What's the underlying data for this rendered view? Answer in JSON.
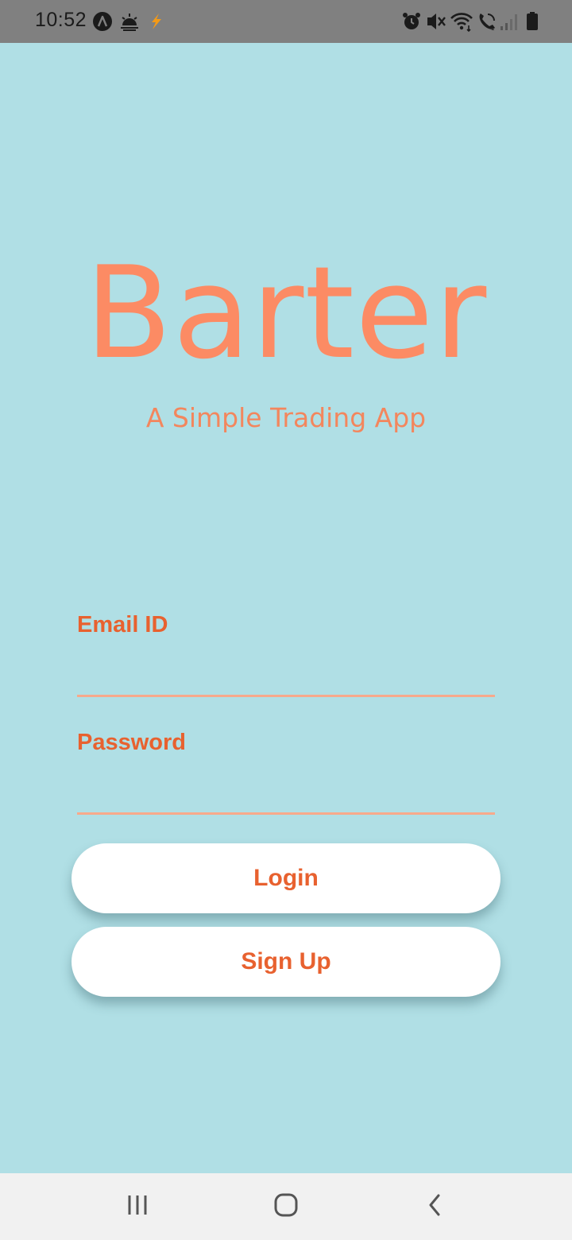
{
  "status_bar": {
    "time": "10:52",
    "left_icons": [
      "a-circle-icon",
      "sunrise-icon",
      "lightning-icon"
    ],
    "right_icons": [
      "alarm-icon",
      "vibrate-mute-icon",
      "wifi-icon",
      "wifi-call-icon",
      "signal-icon",
      "battery-icon"
    ]
  },
  "app": {
    "title": "Barter",
    "subtitle": "A Simple Trading App",
    "colors": {
      "background": "#b0dfe5",
      "accent": "#fc8b64",
      "label": "#e8612f"
    }
  },
  "form": {
    "email_label": "Email ID",
    "email_value": "",
    "password_label": "Password",
    "password_value": ""
  },
  "buttons": {
    "login": "Login",
    "signup": "Sign Up"
  },
  "nav": {
    "icons": [
      "recent-apps-icon",
      "home-icon",
      "back-icon"
    ]
  }
}
